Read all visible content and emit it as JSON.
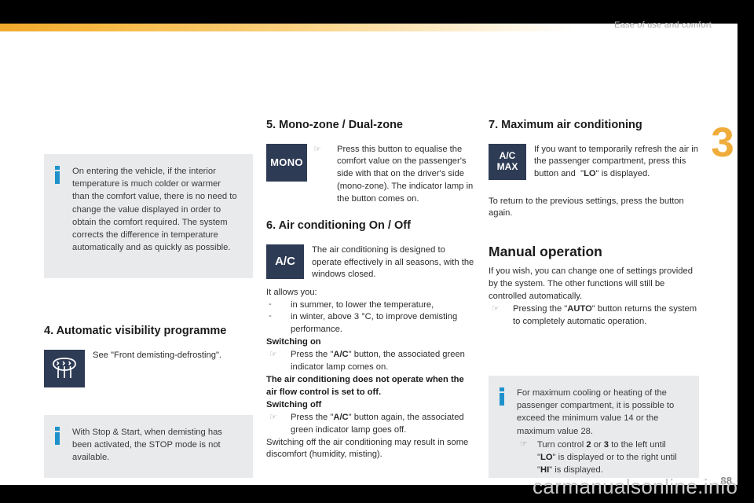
{
  "header": {
    "title": "Ease of use and comfort",
    "chapter_number": "3",
    "accent_color": "#f0ad3c",
    "band_color": "#000000"
  },
  "footer": {
    "watermark": "carmanualsonline.info",
    "page_number": "88"
  },
  "info_icon_color": "#1f92cc",
  "button_color": "#2e3b55",
  "left_column": {
    "info_box_1": {
      "icon": "info-icon",
      "text": "On entering the vehicle, if the interior temperature is much colder or warmer than the comfort value, there is no need to change the value displayed in order to obtain the comfort required. The system corrects the difference in temperature automatically and as quickly as possible."
    },
    "section_4": {
      "heading": "4. Automatic visibility programme",
      "heading_number": "4.",
      "heading_text": "Automatic visibility programme",
      "button_icon": "windscreen-demist-icon",
      "caption": "See \"Front demisting-defrosting\"."
    },
    "info_box_2": {
      "icon": "info-icon",
      "text": "With Stop & Start, when demisting has been activated, the STOP mode is not available."
    }
  },
  "mid_column": {
    "section_5": {
      "heading": "5. Mono-zone / Dual-zone",
      "button_label": "MONO",
      "bullet_glyph": "☞",
      "caption": "Press this button to equalise the comfort value on the passenger's side with that on the driver's side (mono-zone). The indicator lamp in the button comes on."
    },
    "section_6": {
      "heading": "6. Air conditioning On / Off",
      "button_label": "A/C",
      "caption": "The air conditioning is designed to operate effectively in all seasons, with the windows closed.",
      "intro": "It allows you:",
      "dash_items": [
        "in summer, to lower the temperature,",
        "in winter, above 3 °C, to improve demisting performance."
      ],
      "switching_on_label": "Switching on",
      "switching_on_item": "Press the \"A/C\" button, the associated green indicator lamp comes on.",
      "switching_on_item_bold": "A/C",
      "warning": "The air conditioning does not operate when the air flow control is set to off.",
      "switching_off_label": "Switching off",
      "switching_off_item": "Press the \"A/C\" button again, the associated green indicator lamp goes off.",
      "switching_off_item_bold": "A/C",
      "closing": "Switching off the air conditioning may result in some discomfort (humidity, misting)."
    }
  },
  "right_column": {
    "section_7": {
      "heading": "7. Maximum air conditioning",
      "button_label_line1": "A/C",
      "button_label_line2": "MAX",
      "caption": "If you want to temporarily refresh the air in the passenger compartment, press this button and  \"LO\" is displayed.",
      "caption_bold": "LO",
      "paragraph": "To return to the previous settings, press the button again."
    },
    "manual_operation": {
      "heading": "Manual operation",
      "paragraph": "If you wish, you can change one of settings provided by the system. The other functions will still be controlled automatically.",
      "hand_item": "Pressing the \"AUTO\" button returns the system to completely automatic operation.",
      "hand_item_bold": "AUTO"
    },
    "info_box": {
      "icon": "info-icon",
      "text": "For maximum cooling or heating of the passenger compartment, it is possible to exceed the minimum value 14 or the maximum value 28.",
      "min_value": "14",
      "max_value": "28",
      "sub_item": "Turn control 2 or 3 to the left until \"LO\" is displayed or to the right until \"HI\" is displayed.",
      "control_a": "2",
      "control_b": "3",
      "low_label": "LO",
      "high_label": "HI"
    }
  }
}
